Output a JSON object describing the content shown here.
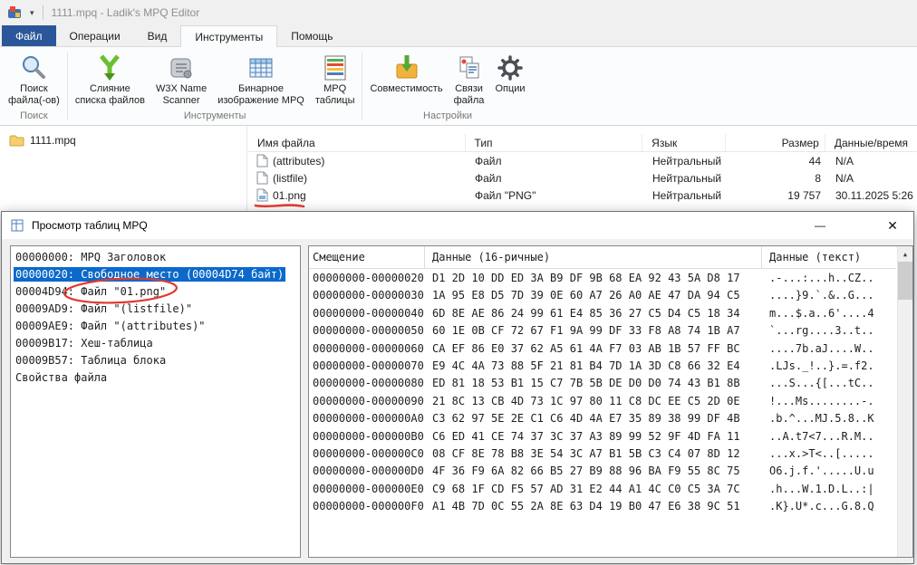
{
  "titlebar": {
    "title": "1111.mpq - Ladik's MPQ Editor",
    "caret": "▾"
  },
  "tabs": {
    "file": "Файл",
    "operations": "Операции",
    "view": "Вид",
    "tools": "Инструменты",
    "help": "Помощь"
  },
  "ribbon": {
    "group_labels": {
      "search": "Поиск",
      "tools": "Инструменты",
      "settings": "Настройки"
    },
    "buttons": {
      "find_files": {
        "line1": "Поиск",
        "line2": "файла(-ов)"
      },
      "merge_listfile": {
        "line1": "Слияние",
        "line2": "списка файлов"
      },
      "w3x_scanner": {
        "line1": "W3X Name",
        "line2": "Scanner"
      },
      "binary_image": {
        "line1": "Бинарное",
        "line2": "изображение MPQ"
      },
      "mpq_tables": {
        "line1": "MPQ",
        "line2": "таблицы"
      },
      "compatibility": {
        "line1": "Совместимость",
        "line2": ""
      },
      "file_links": {
        "line1": "Связи",
        "line2": "файла"
      },
      "options": {
        "line1": "Опции",
        "line2": ""
      }
    }
  },
  "tree": {
    "root_item": "1111.mpq"
  },
  "file_list": {
    "columns": [
      "Имя файла",
      "Тип",
      "Язык",
      "Размер",
      "Данные/время"
    ],
    "rows": [
      {
        "name": "(attributes)",
        "type": "Файл",
        "lang": "Нейтральный",
        "size": "44",
        "datetime": "N/A"
      },
      {
        "name": "(listfile)",
        "type": "Файл",
        "lang": "Нейтральный",
        "size": "8",
        "datetime": "N/A"
      },
      {
        "name": "01.png",
        "type": "Файл \"PNG\"",
        "lang": "Нейтральный",
        "size": "19 757",
        "datetime": "30.11.2025 5:26"
      }
    ]
  },
  "dialog": {
    "title": "Просмотр таблиц MPQ",
    "controls": {
      "minimize": "—",
      "close": "✕"
    },
    "structure_list": [
      {
        "text": "00000000: MPQ Заголовок"
      },
      {
        "text": "00000020: Свободное место (00004D74 байт)",
        "selected": true
      },
      {
        "text": "00004D94: Файл \"01.png\"",
        "annotated": true
      },
      {
        "text": "00009AD9: Файл \"(listfile)\""
      },
      {
        "text": "00009AE9: Файл \"(attributes)\""
      },
      {
        "text": "00009B17: Хеш-таблица"
      },
      {
        "text": "00009B57: Таблица блока"
      },
      {
        "text": "Свойства файла"
      }
    ],
    "hex_view": {
      "columns": [
        "Смещение",
        "Данные (16-ричные)",
        "Данные (текст)"
      ],
      "scroll_up_glyph": "▲",
      "rows": [
        {
          "offset": "00000000-00000020",
          "hex": "D1 2D 10 DD ED 3A B9 DF 9B 68 EA 92 43 5A D8 17",
          "text": ".-...:...h..CZ.."
        },
        {
          "offset": "00000000-00000030",
          "hex": "1A 95 E8 D5 7D 39 0E 60 A7 26 A0 AE 47 DA 94 C5",
          "text": "....}9.`.&..G..."
        },
        {
          "offset": "00000000-00000040",
          "hex": "6D 8E AE 86 24 99 61 E4 85 36 27 C5 D4 C5 18 34",
          "text": "m...$.a..6'....4"
        },
        {
          "offset": "00000000-00000050",
          "hex": "60 1E 0B CF 72 67 F1 9A 99 DF 33 F8 A8 74 1B A7",
          "text": "`...rg....3..t.."
        },
        {
          "offset": "00000000-00000060",
          "hex": "CA EF 86 E0 37 62 A5 61 4A F7 03 AB 1B 57 FF BC",
          "text": "....7b.aJ....W.."
        },
        {
          "offset": "00000000-00000070",
          "hex": "E9 4C 4A 73 88 5F 21 81 B4 7D 1A 3D C8 66 32 E4",
          "text": ".LJs._!..}.=.f2."
        },
        {
          "offset": "00000000-00000080",
          "hex": "ED 81 18 53 B1 15 C7 7B 5B DE D0 D0 74 43 B1 8B",
          "text": "...S...{[...tC.."
        },
        {
          "offset": "00000000-00000090",
          "hex": "21 8C 13 CB 4D 73 1C 97 80 11 C8 DC EE C5 2D 0E",
          "text": "!...Ms........-."
        },
        {
          "offset": "00000000-000000A0",
          "hex": "C3 62 97 5E 2E C1 C6 4D 4A E7 35 89 38 99 DF 4B",
          "text": ".b.^...MJ.5.8..K"
        },
        {
          "offset": "00000000-000000B0",
          "hex": "C6 ED 41 CE 74 37 3C 37 A3 89 99 52 9F 4D FA 11",
          "text": "..A.t7<7...R.M.."
        },
        {
          "offset": "00000000-000000C0",
          "hex": "08 CF 8E 78 B8 3E 54 3C A7 B1 5B C3 C4 07 8D 12",
          "text": "...x.>T<..[....."
        },
        {
          "offset": "00000000-000000D0",
          "hex": "4F 36 F9 6A 82 66 B5 27 B9 88 96 BA F9 55 8C 75",
          "text": "O6.j.f.'.....U.u"
        },
        {
          "offset": "00000000-000000E0",
          "hex": "C9 68 1F CD F5 57 AD 31 E2 44 A1 4C C0 C5 3A 7C",
          "text": ".h...W.1.D.L..:|"
        },
        {
          "offset": "00000000-000000F0",
          "hex": "A1 4B 7D 0C 55 2A 8E 63 D4 19 B0 47 E6 38 9C 51",
          "text": ".K}.U*.c...G.8.Q"
        }
      ]
    }
  },
  "colors": {
    "selection": "#0b69cb",
    "accent_tab": "#2b579a",
    "annotation": "#e0392e"
  }
}
